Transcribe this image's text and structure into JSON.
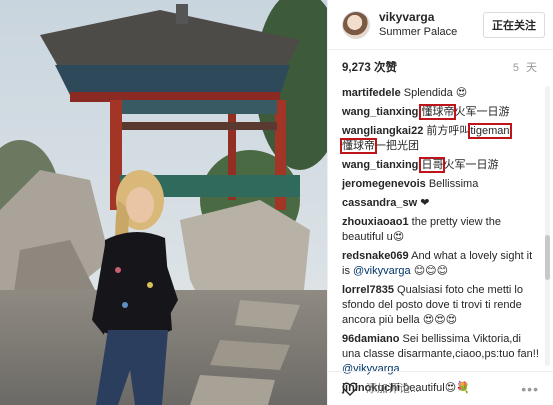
{
  "post": {
    "username": "vikyvarga",
    "location": "Summer Palace",
    "follow_label": "正在关注",
    "likes": "9,273 次赞",
    "age": "5 天"
  },
  "comments": [
    {
      "user": "martifedele",
      "text": " Splendida 😍"
    },
    {
      "user": "wang_tianxing",
      "hl": "懂球帝",
      "rest": "火军一日游"
    },
    {
      "user": "wangliangkai22",
      "text": " 前方呼叫",
      "hl2": "tigeman",
      "line2hl": "懂球帝",
      "line2": "一把光团"
    },
    {
      "user": "wang_tianxing",
      "hl": "日哥",
      "rest": "火军一日游"
    },
    {
      "user": "jeromegenevois",
      "text": " Bellissima"
    },
    {
      "user": "cassandra_sw",
      "text": " ❤"
    },
    {
      "user": "zhouxiaoao1",
      "text": " the pretty view the beautiful u😍"
    },
    {
      "user": "redsnake069",
      "text": " And what a lovely sight it is ",
      "mention": "@vikyvarga",
      "tail": " 😊😊😊"
    },
    {
      "user": "lorrel7835",
      "text": " Qualsiasi foto che metti lo sfondo del posto dove ti trovi ti rende ancora più bella 😍😍😍"
    },
    {
      "user": "96damiano",
      "text": " Sei bellissima Viktoria,di una classe disarmante,ciaoo,ps:tuo fan!!",
      "mention": "@vikyvarga",
      "tail": ""
    },
    {
      "user": "jininokuchi",
      "text": " beautiful😍💐"
    }
  ],
  "footer": {
    "add_comment_placeholder": "添加评论...",
    "more_label": "•••"
  }
}
